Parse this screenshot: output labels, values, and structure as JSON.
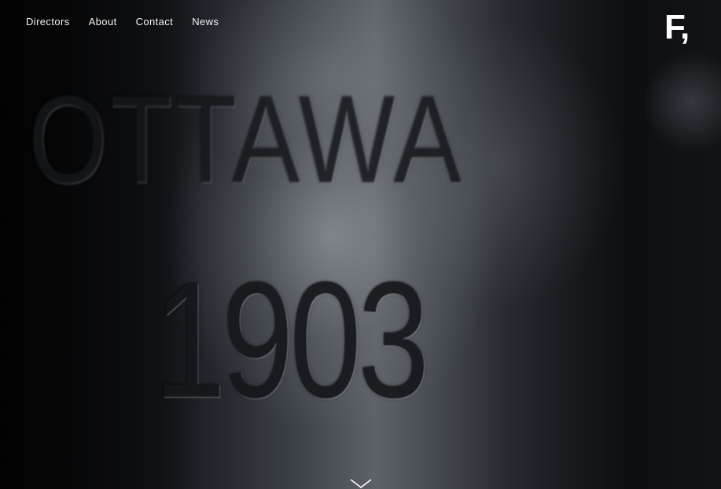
{
  "nav": {
    "items": [
      {
        "label": "Directors"
      },
      {
        "label": "About"
      },
      {
        "label": "Contact"
      },
      {
        "label": "News"
      }
    ]
  },
  "logo": {
    "text": "F,"
  },
  "hero": {
    "engraved_word": "OTTAWA",
    "engraved_year": "1903"
  },
  "icons": {
    "scroll": "chevron-down-icon"
  },
  "colors": {
    "nav_text": "#f2f2f2",
    "background": "#0b0d10"
  }
}
